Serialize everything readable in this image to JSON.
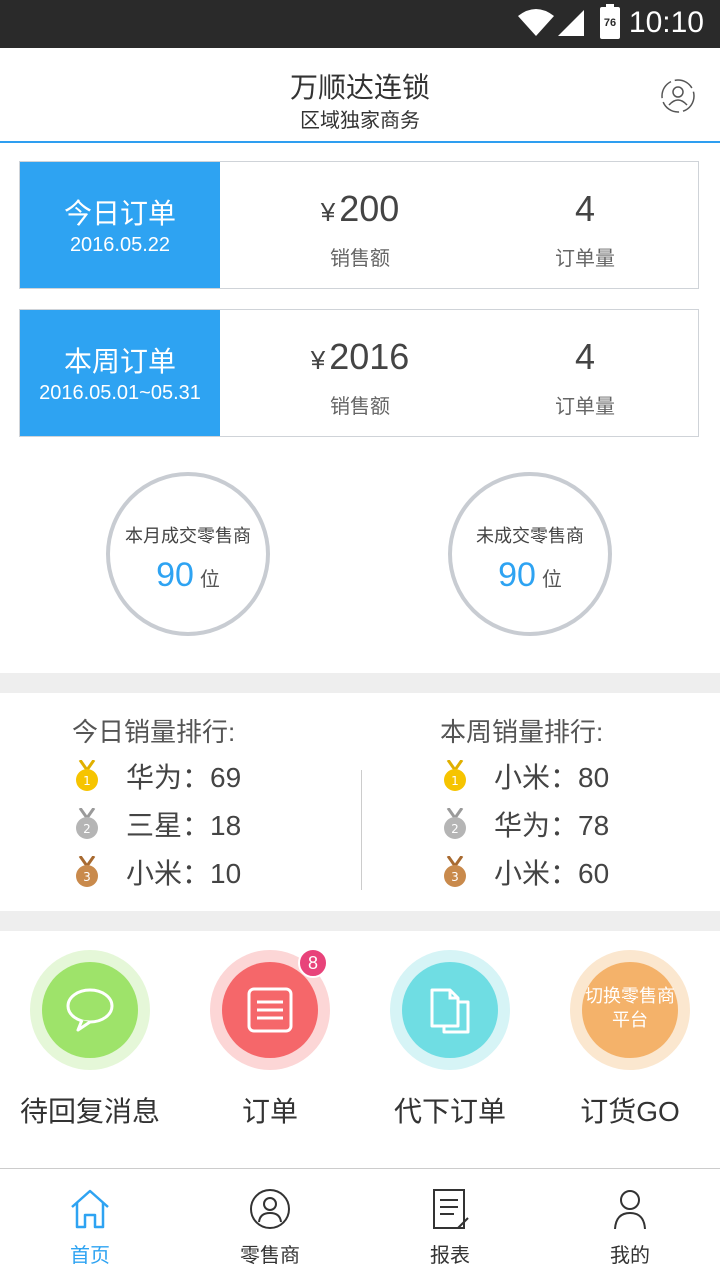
{
  "status_bar": {
    "time": "10:10",
    "battery_level": "76"
  },
  "header": {
    "title": "万顺达连锁",
    "subtitle": "区域独家商务",
    "profile_icon": "user-switch-icon"
  },
  "today_orders": {
    "label": "今日订单",
    "date": "2016.05.22",
    "currency": "¥",
    "sales": "200",
    "sales_label": "销售额",
    "count": "4",
    "count_label": "订单量"
  },
  "week_orders": {
    "label": "本周订单",
    "date": "2016.05.01~05.31",
    "currency": "¥",
    "sales": "2016",
    "sales_label": "销售额",
    "count": "4",
    "count_label": "订单量"
  },
  "stats": [
    {
      "label": "本月成交零售商",
      "value": "90",
      "unit": "位"
    },
    {
      "label": "未成交零售商",
      "value": "90",
      "unit": "位"
    }
  ],
  "rankings": {
    "today": {
      "title": "今日销量排行:",
      "items": [
        {
          "text": "华为：69",
          "medal": "gold-medal-icon"
        },
        {
          "text": "三星：18",
          "medal": "silver-medal-icon"
        },
        {
          "text": "小米：10",
          "medal": "bronze-medal-icon"
        }
      ]
    },
    "week": {
      "title": "本周销量排行:",
      "items": [
        {
          "text": "小米：80",
          "medal": "gold-medal-icon"
        },
        {
          "text": "华为：78",
          "medal": "silver-medal-icon"
        },
        {
          "text": "小米：60",
          "medal": "bronze-medal-icon"
        }
      ]
    }
  },
  "actions": [
    {
      "label": "待回复消息",
      "icon": "chat-bubble-icon",
      "color": "#9ee36a"
    },
    {
      "label": "订单",
      "icon": "order-list-icon",
      "color": "#f5676a",
      "badge": "8"
    },
    {
      "label": "代下订单",
      "icon": "documents-icon",
      "color": "#6fdde3"
    },
    {
      "label": "订货GO",
      "icon": "switch-platform-icon",
      "color": "#f4b26a",
      "inner_text": "切换零售商平台"
    }
  ],
  "tabs": [
    {
      "label": "首页",
      "icon": "home-icon",
      "active": true
    },
    {
      "label": "零售商",
      "icon": "retailer-icon"
    },
    {
      "label": "报表",
      "icon": "report-icon"
    },
    {
      "label": "我的",
      "icon": "profile-icon"
    }
  ],
  "colors": {
    "accent": "#2ea3f2",
    "badge": "#e8437a"
  }
}
